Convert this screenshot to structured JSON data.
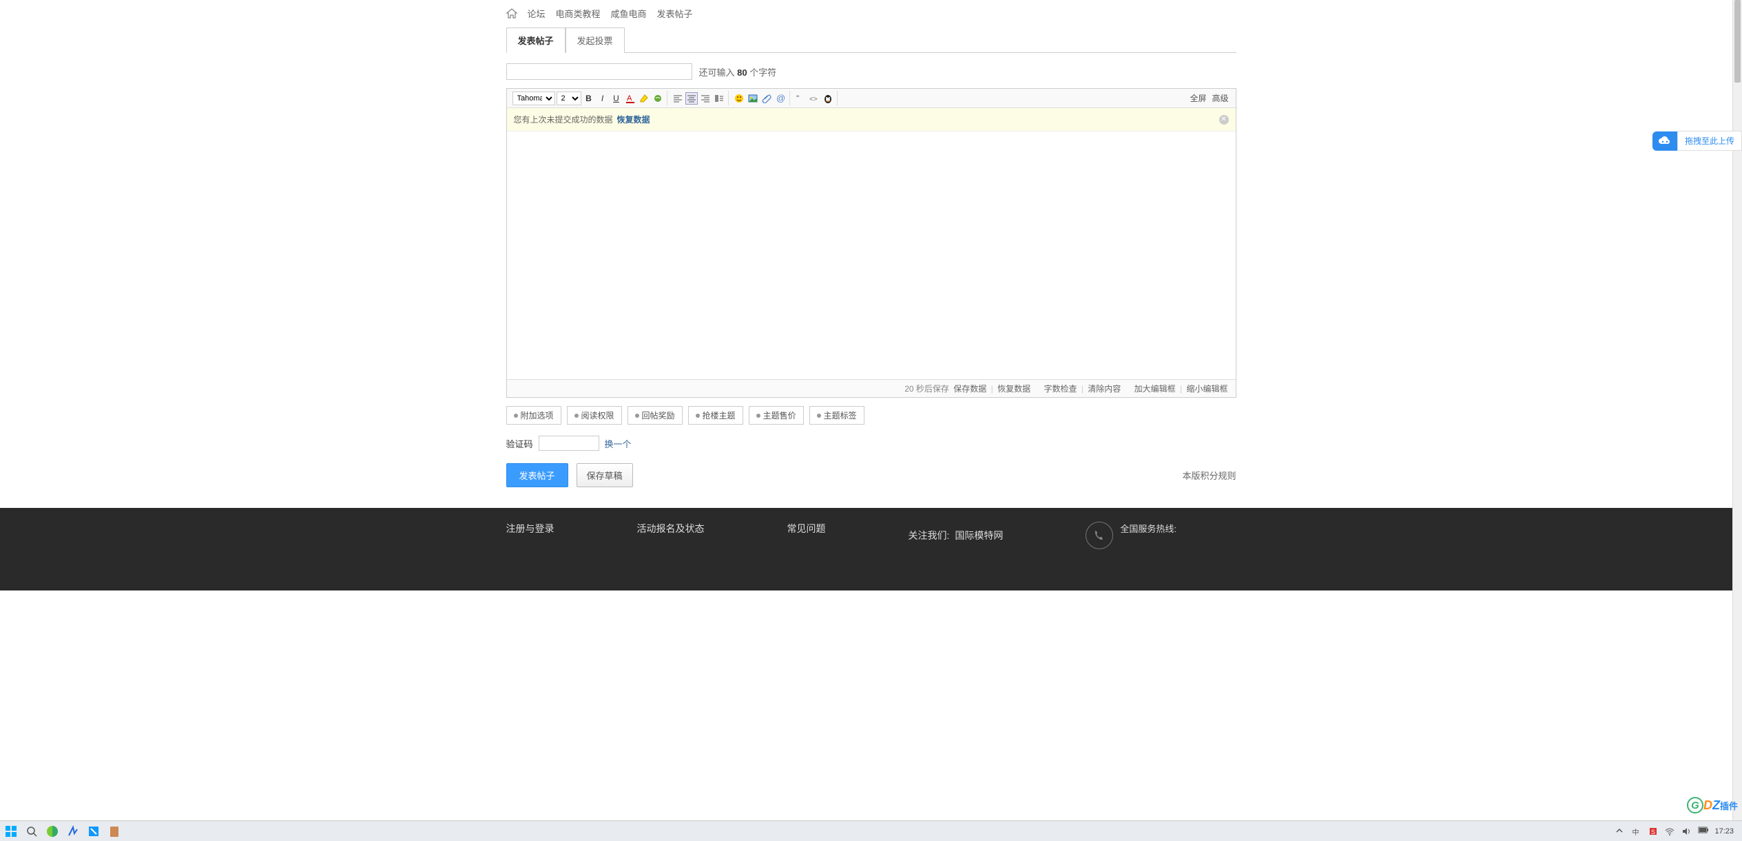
{
  "breadcrumb": {
    "items": [
      "论坛",
      "电商类教程",
      "咸鱼电商",
      "发表帖子"
    ]
  },
  "tabs": {
    "post": "发表帖子",
    "poll": "发起投票"
  },
  "title_input": {
    "value": "",
    "hint_prefix": "还可输入 ",
    "count": "80",
    "hint_suffix": " 个字符"
  },
  "toolbar": {
    "font_name": "Tahoma",
    "font_size": "2",
    "right": {
      "fullscreen": "全屏",
      "advanced": "高级"
    }
  },
  "restore": {
    "text": "您有上次未提交成功的数据",
    "link": "恢复数据"
  },
  "status": {
    "autosave": "20 秒后保存",
    "save": "保存数据",
    "restore": "恢复数据",
    "wordcheck": "字数检查",
    "clear": "清除内容",
    "enlarge": "加大编辑框",
    "shrink": "缩小编辑框"
  },
  "options": [
    "附加选项",
    "阅读权限",
    "回帖奖励",
    "抢楼主题",
    "主题售价",
    "主题标签"
  ],
  "captcha": {
    "label": "验证码",
    "change": "换一个"
  },
  "submit": {
    "publish": "发表帖子",
    "draft": "保存草稿",
    "rules": "本版积分规则"
  },
  "upload": {
    "label": "拖拽至此上传"
  },
  "footer": {
    "col1": "注册与登录",
    "col2": "活动报名及状态",
    "col3": "常见问题",
    "follow_label": "关注我们:",
    "follow_name": "国际模特网",
    "hotline": "全国服务热线:"
  },
  "dz": {
    "d": "D",
    "z": "Z",
    "txt": "插件"
  },
  "taskbar": {
    "time": "17:23"
  },
  "browser_top": ""
}
